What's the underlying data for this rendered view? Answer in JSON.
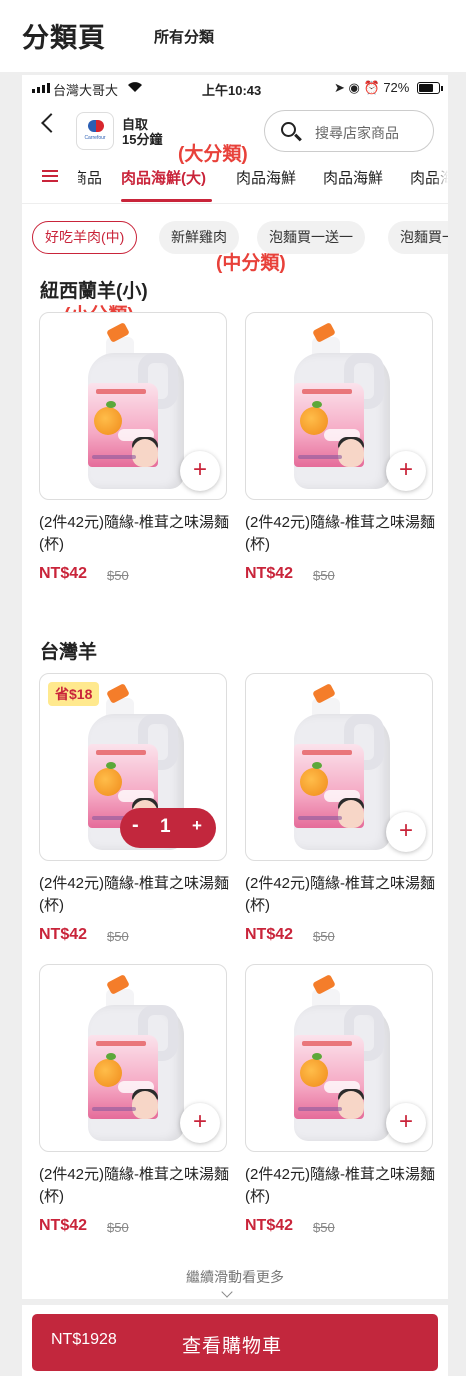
{
  "header": {
    "title": "分類頁",
    "subtitle": "所有分類"
  },
  "status": {
    "carrier": "台灣大哥大",
    "time": "上午10:43",
    "battery": "72%"
  },
  "store": {
    "mode": "自取",
    "eta": "15分鐘"
  },
  "search": {
    "placeholder": "搜尋店家商品"
  },
  "annotations": {
    "big": "(大分類)",
    "mid": "(中分類)",
    "small": "(小分類)"
  },
  "categories": {
    "tabs": [
      {
        "label": "商品"
      },
      {
        "label": "肉品海鮮(大)"
      },
      {
        "label": "肉品海鮮"
      },
      {
        "label": "肉品海鮮"
      },
      {
        "label": "肉品海"
      }
    ]
  },
  "subcategories": [
    {
      "label": "好吃羊肉(中)"
    },
    {
      "label": "新鮮雞肉"
    },
    {
      "label": "泡麵買一送一"
    },
    {
      "label": "泡麵買一"
    }
  ],
  "sections": [
    {
      "title": "紐西蘭羊(小)"
    },
    {
      "title": "台灣羊"
    }
  ],
  "product": {
    "name": "(2件42元)隨緣-椎茸之味湯麵(杯)",
    "price": "NT$42",
    "original_price": "$50"
  },
  "badge": {
    "text": "省$18"
  },
  "stepper": {
    "minus": "-",
    "quantity": "1",
    "plus": "+"
  },
  "add_label": "+",
  "more": "繼續滑動看更多",
  "cart": {
    "total": "NT$1928",
    "label": "查看購物車"
  },
  "colors": {
    "accent": "#c9243a",
    "annotation": "#e8413a",
    "badge_bg": "#ffe98e"
  }
}
